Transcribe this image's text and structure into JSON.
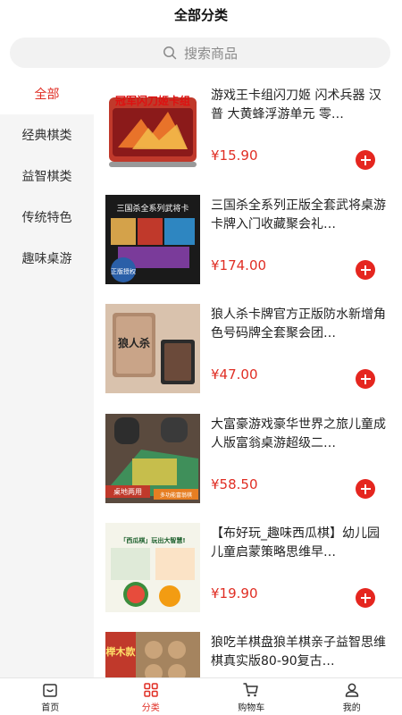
{
  "header": {
    "title": "全部分类"
  },
  "search": {
    "placeholder": "搜索商品",
    "icon": "search-icon"
  },
  "sidebar": {
    "items": [
      {
        "label": "全部",
        "active": true
      },
      {
        "label": "经典棋类",
        "active": false
      },
      {
        "label": "益智棋类",
        "active": false
      },
      {
        "label": "传统特色",
        "active": false
      },
      {
        "label": "趣味桌游",
        "active": false
      }
    ]
  },
  "products": [
    {
      "title": "游戏王卡组闪刀姬 闪术兵器 汉普 大黄蜂浮游单元 零…",
      "price": "¥15.90",
      "thumb_text": "冠军闪刀姬卡组"
    },
    {
      "title": "三国杀全系列正版全套武将桌游卡牌入门收藏聚会礼…",
      "price": "¥174.00",
      "thumb_text": "三国杀全系列武将卡",
      "thumb_badge": "正版授权"
    },
    {
      "title": "狼人杀卡牌官方正版防水新增角色号码牌全套聚会团…",
      "price": "¥47.00",
      "thumb_text": "狼人杀"
    },
    {
      "title": "大富豪游戏豪华世界之旅儿童成人版富翁桌游超级二…",
      "price": "¥58.50",
      "thumb_text": "桌地两用",
      "thumb_badge": "多功能富翁棋"
    },
    {
      "title": "【布好玩_趣味西瓜棋】幼儿园儿童启蒙策略思维早…",
      "price": "¥19.90",
      "thumb_text": "「西瓜棋」玩出大智慧!"
    },
    {
      "title": "狼吃羊棋盘狼羊棋亲子益智思维棋真实版80-90复古…",
      "price": "",
      "thumb_text": "榉木款"
    }
  ],
  "tabbar": {
    "items": [
      {
        "label": "首页",
        "icon": "home-icon",
        "active": false
      },
      {
        "label": "分类",
        "icon": "category-grid-icon",
        "active": true
      },
      {
        "label": "购物车",
        "icon": "cart-icon",
        "active": false
      },
      {
        "label": "我的",
        "icon": "user-icon",
        "active": false
      }
    ]
  },
  "colors": {
    "accent": "#e02e24",
    "sidebar_bg": "#f5f5f5",
    "search_bg": "#f2f2f2"
  }
}
